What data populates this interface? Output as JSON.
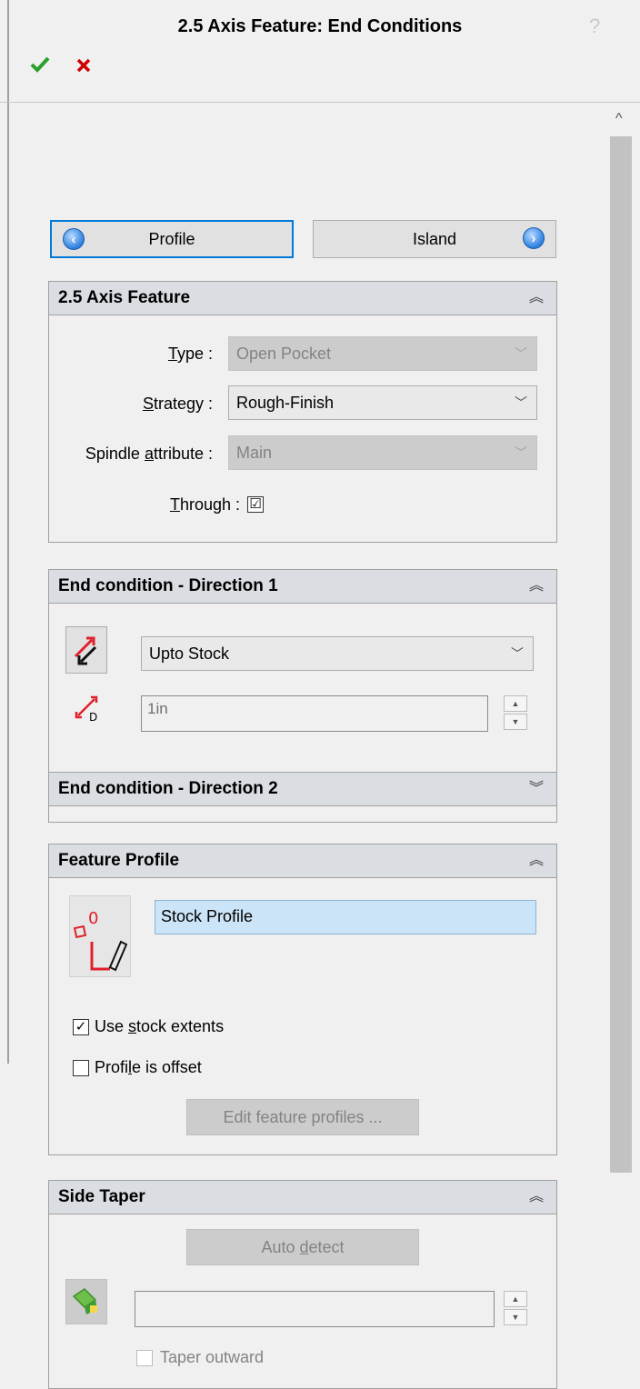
{
  "window": {
    "title": "2.5 Axis Feature: End Conditions",
    "help_glyph": "?"
  },
  "nav": {
    "prev_label": "Profile",
    "next_label": "Island"
  },
  "feature_group": {
    "title": "2.5 Axis Feature",
    "type_label_u": "T",
    "type_label_rest": "ype :",
    "type_value": "Open Pocket",
    "strategy_label_u": "S",
    "strategy_label_rest": "trategy :",
    "strategy_value": "Rough-Finish",
    "spindle_label_pre": "Spindle ",
    "spindle_label_u": "a",
    "spindle_label_rest": "ttribute :",
    "spindle_value": "Main",
    "through_label_u": "T",
    "through_label_rest": "hrough :",
    "through_checked": "☑"
  },
  "dir1_group": {
    "title": "End condition - Direction 1",
    "condition_value": "Upto Stock",
    "depth_value": "1in"
  },
  "dir2_group": {
    "title": "End condition - Direction 2"
  },
  "profile_group": {
    "title": "Feature Profile",
    "profile_value": "Stock Profile",
    "use_extents_pre": "Use ",
    "use_extents_u": "s",
    "use_extents_rest": "tock extents",
    "use_extents_checked": "✓",
    "offset_pre": "Profi",
    "offset_u": "l",
    "offset_rest": "e is offset",
    "edit_button": "Edit feature profiles ..."
  },
  "taper_group": {
    "title": "Side Taper",
    "auto_pre": "Auto ",
    "auto_u": "d",
    "auto_rest": "etect",
    "taper_outward": "Taper outward"
  },
  "colors": {
    "accent": "#0078d7",
    "ok": "#2aa02a",
    "cancel": "#d00000",
    "header_bg": "#dadde2"
  }
}
